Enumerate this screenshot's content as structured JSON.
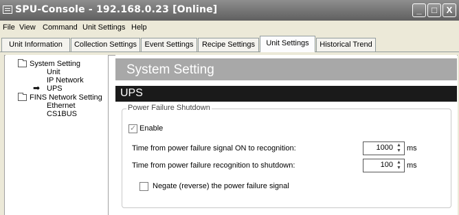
{
  "window": {
    "title": "SPU-Console - 192.168.0.23 [Online]",
    "controls": {
      "minimize": "_",
      "maximize": "□",
      "close": "X"
    }
  },
  "menu": {
    "items": [
      {
        "label": "File"
      },
      {
        "label": "View"
      },
      {
        "label": "Command"
      },
      {
        "label": "Unit Settings"
      },
      {
        "label": "Help"
      }
    ]
  },
  "tabs": [
    {
      "label": "Unit Information"
    },
    {
      "label": "Collection Settings"
    },
    {
      "label": "Event Settings"
    },
    {
      "label": "Recipe Settings"
    },
    {
      "label": "Unit Settings",
      "active": true
    },
    {
      "label": "Historical Trend"
    }
  ],
  "tree": {
    "system_setting": "System Setting",
    "unit": "Unit",
    "ip_network": "IP Network",
    "ups": "UPS",
    "fins_network": "FINS Network Setting",
    "ethernet": "Ethernet",
    "cs1bus": "CS1BUS"
  },
  "content": {
    "header": "System Setting",
    "section": "UPS",
    "group_label": "Power Failure Shutdown",
    "enable_label": "Enable",
    "enable_checked": true,
    "time_on_label": "Time from power failure signal ON to recognition:",
    "time_on_value": "1000",
    "time_on_unit": "ms",
    "time_shutdown_label": "Time from power failure recognition to shutdown:",
    "time_shutdown_value": "100",
    "time_shutdown_unit": "ms",
    "negate_label": "Negate (reverse) the power failure signal",
    "negate_checked": false
  },
  "colors": {
    "titlebar": "#707070",
    "section_bar": "#1a1a1a",
    "header_bar": "#a8a8a8"
  }
}
